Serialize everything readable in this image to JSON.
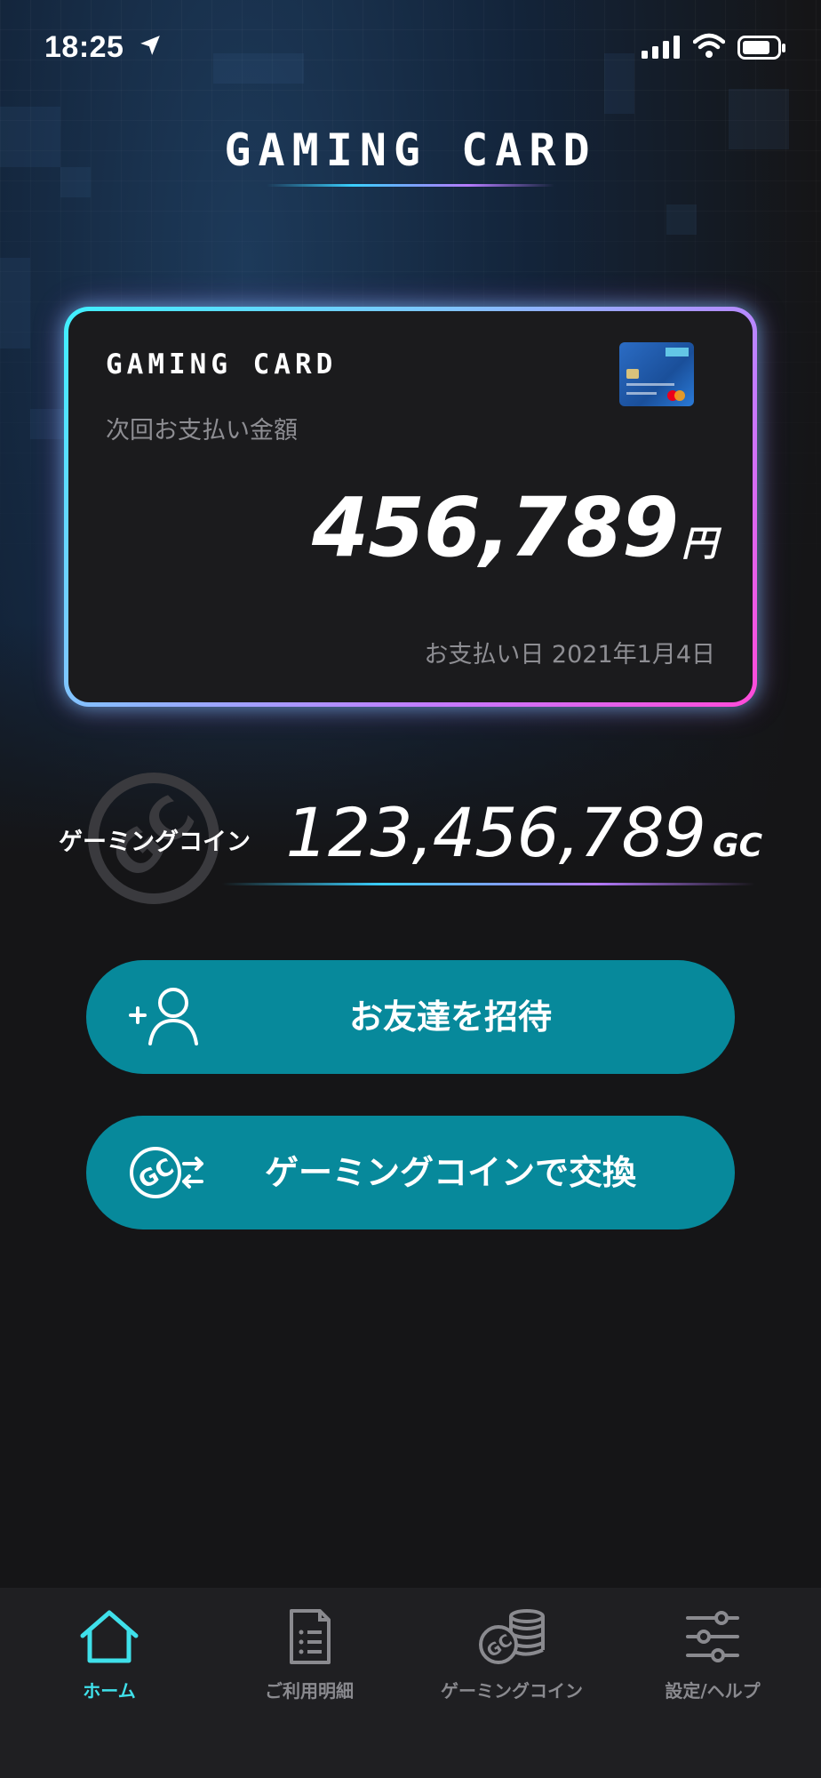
{
  "status_bar": {
    "time": "18:25"
  },
  "header": {
    "title": "GAMING CARD"
  },
  "card": {
    "brand": "GAMING CARD",
    "next_payment_label": "次回お支払い金額",
    "amount": "456,789",
    "currency": "円",
    "payment_date": "お支払い日 2021年1月4日"
  },
  "coin": {
    "label": "ゲーミングコイン",
    "amount": "123,456,789",
    "unit": "GC"
  },
  "actions": {
    "invite_label": "お友達を招待",
    "exchange_label": "ゲーミングコインで交換"
  },
  "nav": {
    "items": [
      {
        "label": "ホーム",
        "icon": "home-icon",
        "active": true
      },
      {
        "label": "ご利用明細",
        "icon": "statement-icon",
        "active": false
      },
      {
        "label": "ゲーミングコイン",
        "icon": "coin-stack-icon",
        "active": false
      },
      {
        "label": "設定/ヘルプ",
        "icon": "settings-sliders-icon",
        "active": false
      }
    ]
  },
  "colors": {
    "accent_teal": "#07899b",
    "active_nav": "#3fe0ea",
    "background": "#141416"
  }
}
